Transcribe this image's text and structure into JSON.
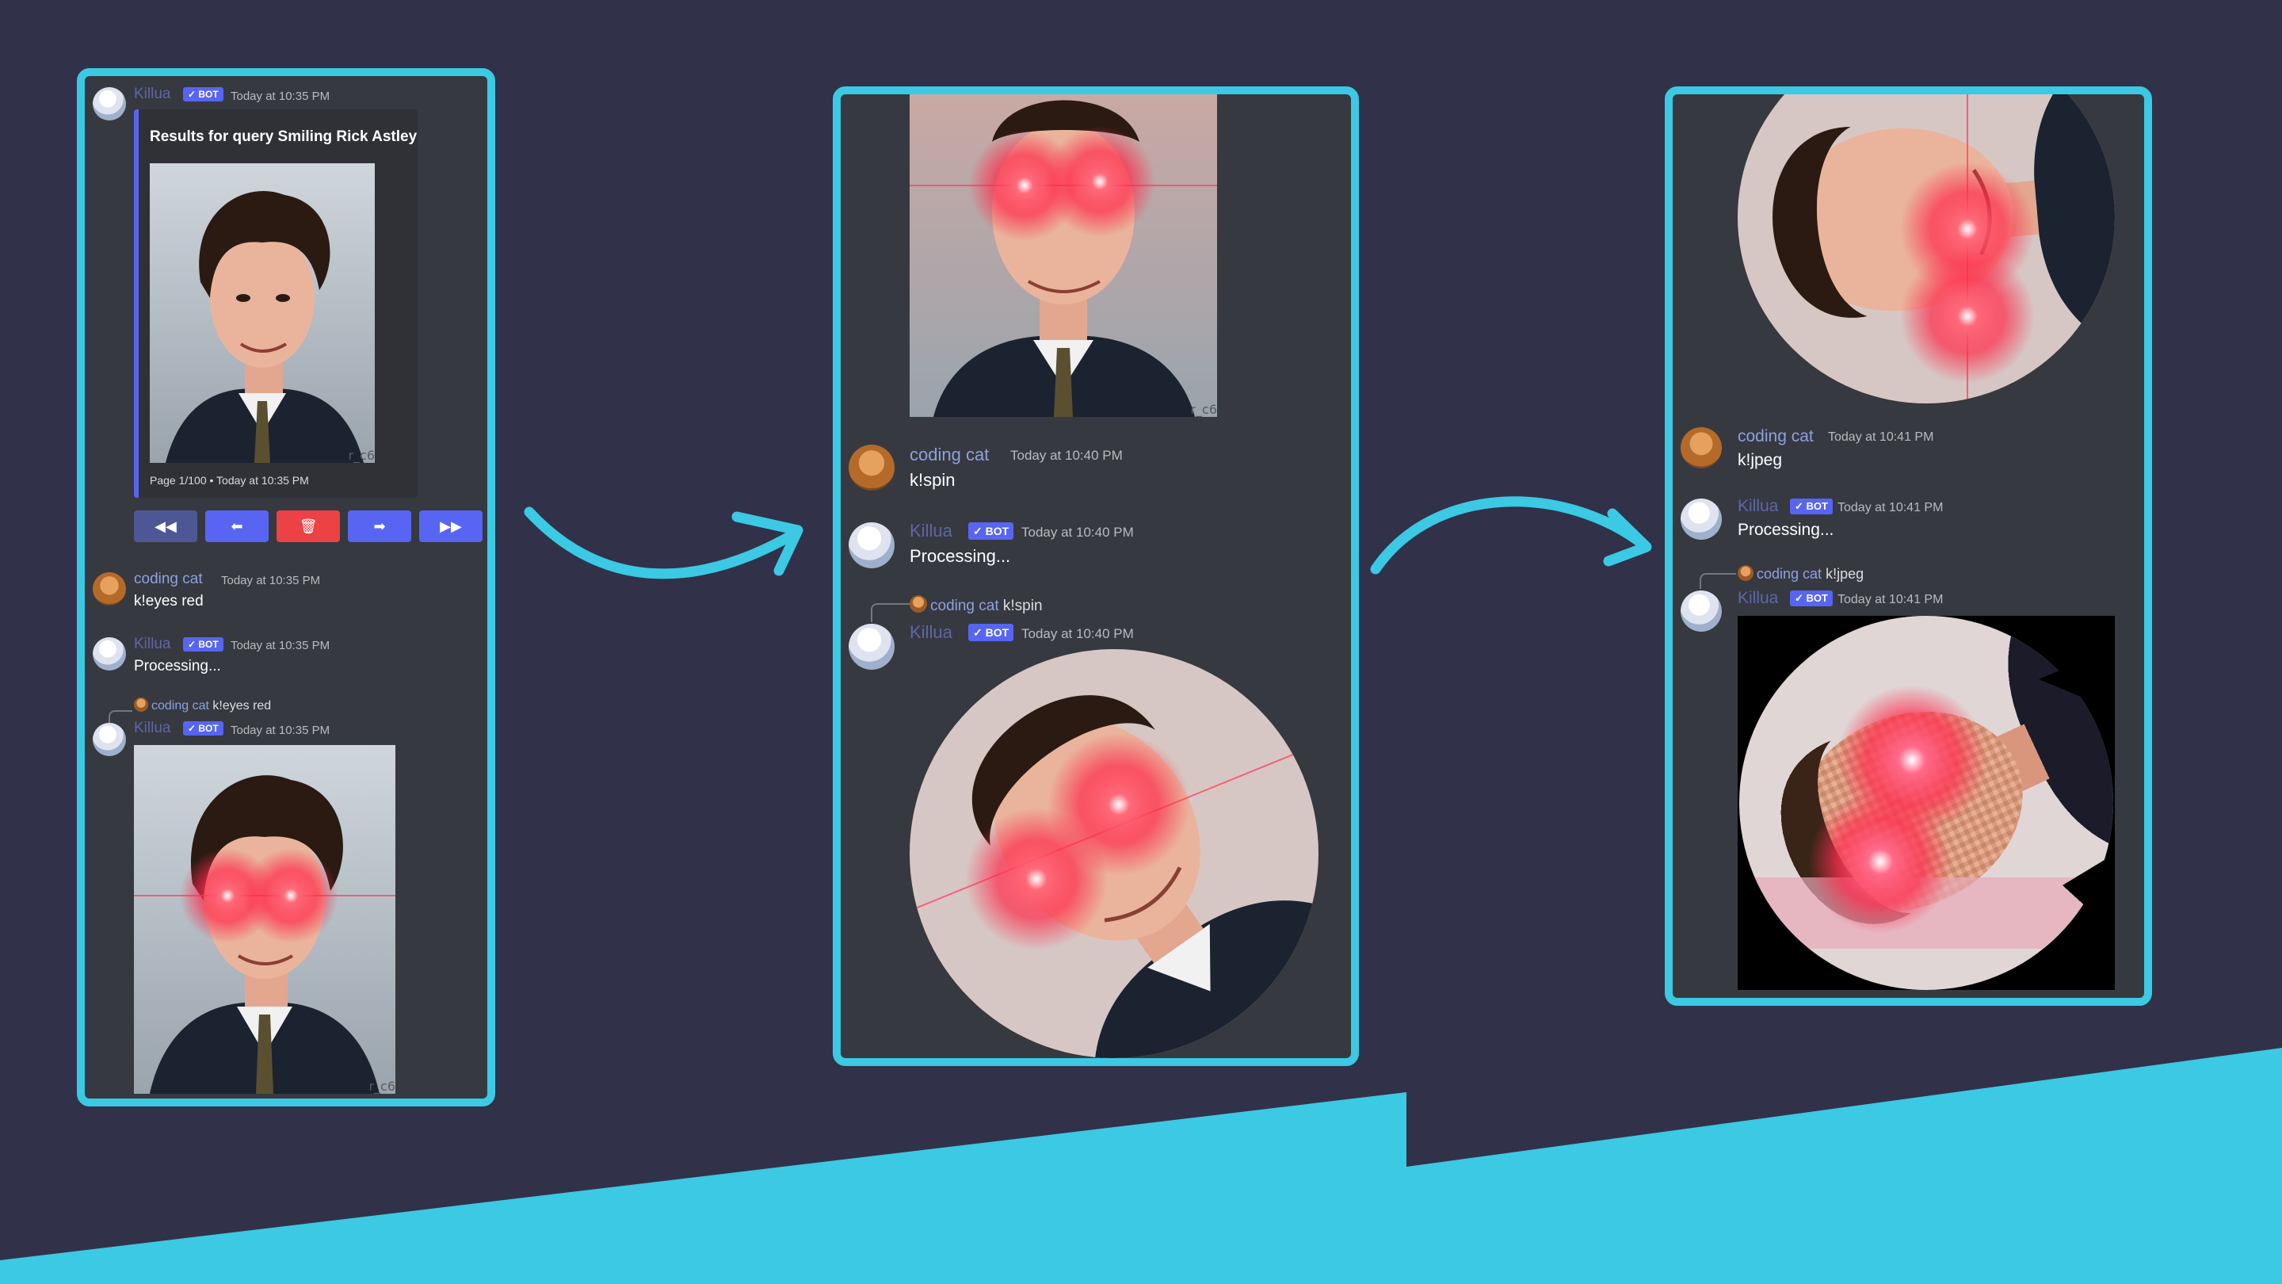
{
  "colors": {
    "background": "#31314a",
    "accent": "#3bc9e3",
    "discord_bg": "#36393f",
    "blurple": "#5865f2",
    "danger": "#ed4245"
  },
  "panel1": {
    "bot_name": "Killua",
    "bot_badge": "✓ BOT",
    "embed_ts": "Today at 10:35 PM",
    "embed_title": "Results for query Smiling Rick Astley",
    "embed_footer": "Page 1/100 • Today at 10:35 PM",
    "watermark": "r_c6",
    "buttons": [
      {
        "icon": "first-page-icon",
        "glyph": "◀◀"
      },
      {
        "icon": "prev-page-icon",
        "glyph": "⬅"
      },
      {
        "icon": "trash-icon",
        "glyph": "🗑"
      },
      {
        "icon": "next-page-icon",
        "glyph": "➡"
      },
      {
        "icon": "last-page-icon",
        "glyph": "▶▶"
      }
    ],
    "user_name": "coding cat",
    "user_ts": "Today at 10:35 PM",
    "user_cmd": "k!eyes red",
    "bot2_ts": "Today at 10:35 PM",
    "processing": "Processing...",
    "reply_name": "coding cat",
    "reply_text": "k!eyes red",
    "bot3_ts": "Today at 10:35 PM",
    "watermark2": "r_c6"
  },
  "panel2": {
    "watermark": "r_c6",
    "user_name": "coding cat",
    "user_ts": "Today at 10:40 PM",
    "user_cmd": "k!spin",
    "bot_name": "Killua",
    "bot_badge": "✓ BOT",
    "bot_ts": "Today at 10:40 PM",
    "processing": "Processing...",
    "reply_name": "coding cat",
    "reply_text": "k!spin",
    "bot2_ts": "Today at 10:40 PM"
  },
  "panel3": {
    "user_name": "coding cat",
    "user_ts": "Today at 10:41 PM",
    "user_cmd": "k!jpeg",
    "bot_name": "Killua",
    "bot_badge": "✓ BOT",
    "bot_ts": "Today at 10:41 PM",
    "processing": "Processing...",
    "reply_name": "coding cat",
    "reply_text": "k!jpeg",
    "bot2_ts": "Today at 10:41 PM"
  }
}
